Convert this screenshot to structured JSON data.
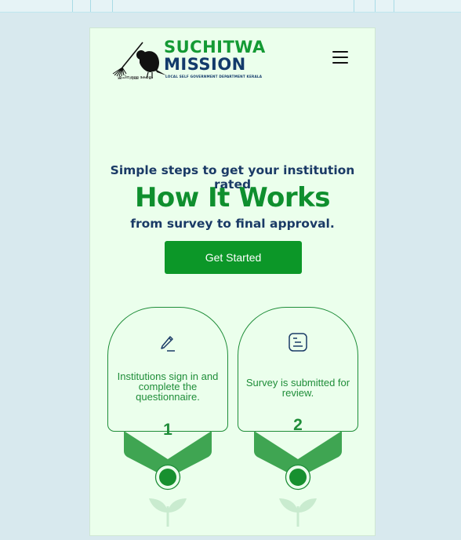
{
  "brand": {
    "name_line1": "SUCHITWA",
    "name_line2": "MISSION",
    "tagline": "LOCAL SELF GOVERNMENT DEPARTMENT KERALA",
    "malayalam": "ശുചിത്വമുള്ള കേരളം",
    "colors": {
      "green": "#149a34",
      "navy": "#133a6b"
    }
  },
  "header": {
    "menu_icon": "hamburger-menu-icon"
  },
  "hero": {
    "kicker": "Simple steps to get your institution rated",
    "title": "How It Works",
    "subtitle": "from survey to final approval.",
    "cta_label": "Get Started"
  },
  "steps": [
    {
      "number": "1",
      "text": "Institutions sign in and complete the questionnaire.",
      "icon": "pen-signature-icon"
    },
    {
      "number": "2",
      "text": "Survey is submitted for review.",
      "icon": "document-list-icon"
    }
  ],
  "colors": {
    "primary": "#0c9728",
    "page_bg": "#ebffec",
    "title_green": "#0f8f2e",
    "text_navy": "#1a3a66"
  }
}
